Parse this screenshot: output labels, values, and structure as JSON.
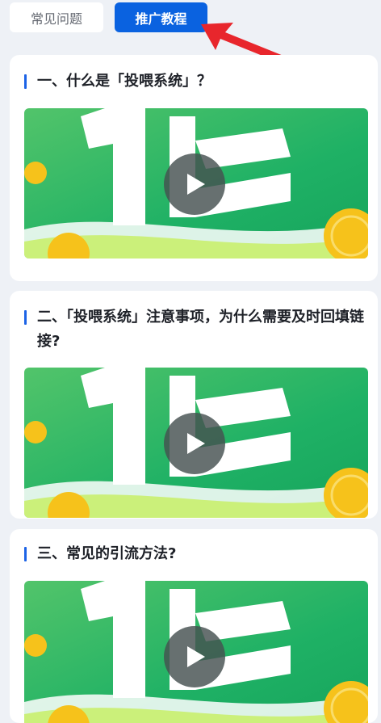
{
  "tabs": {
    "faq_label": "常见问题",
    "tutorial_label": "推广教程",
    "active": "tutorial"
  },
  "annotation": {
    "icon": "red-arrow-icon",
    "color": "#e8262c"
  },
  "theme": {
    "accent": "#0a62e0",
    "title_bar": "#1c63e6",
    "thumbnail_green": "#22b366",
    "coin": "#f6c21b"
  },
  "cards": [
    {
      "title": "一、什么是「投喂系统」？",
      "video": {
        "thumbnail": "green-promo-thumbnail",
        "icon": "play-icon"
      }
    },
    {
      "title": "二、「投喂系统」注意事项，为什么需要及时回填链接?",
      "video": {
        "thumbnail": "green-promo-thumbnail",
        "icon": "play-icon"
      }
    },
    {
      "title": "三、常见的引流方法?",
      "video": {
        "thumbnail": "green-promo-thumbnail",
        "icon": "play-icon"
      }
    }
  ]
}
